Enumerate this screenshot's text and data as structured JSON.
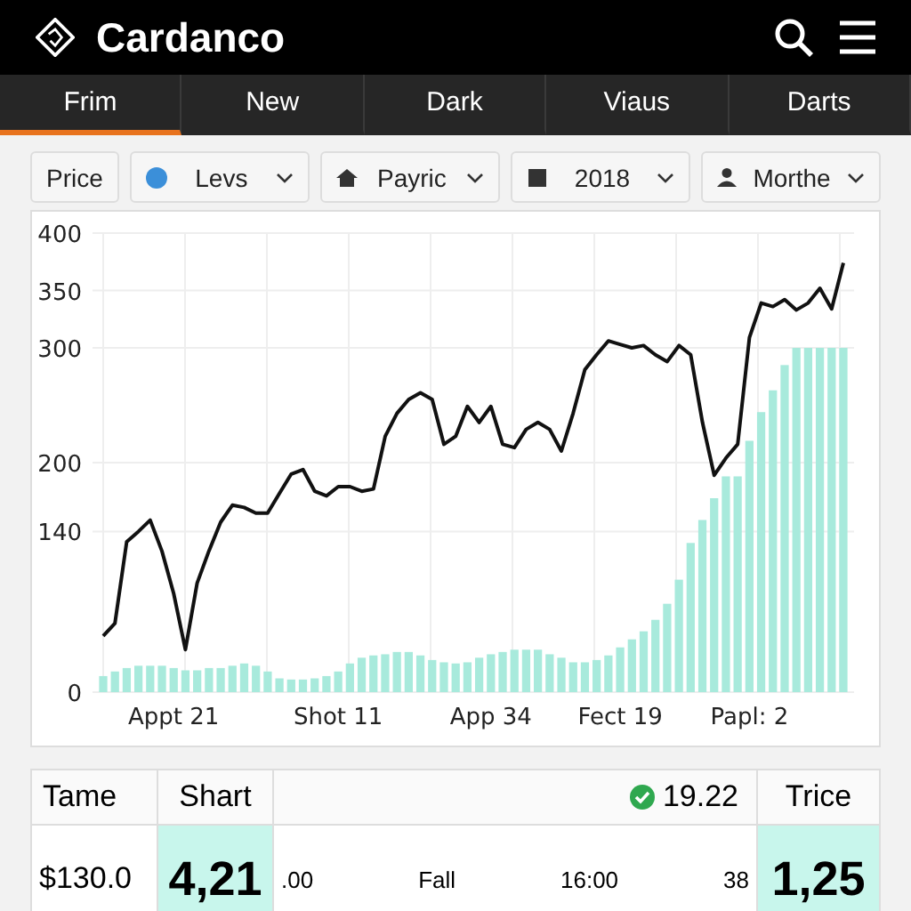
{
  "app": {
    "title": "Cardanco"
  },
  "tabs": [
    {
      "label": "Frim",
      "selected": true
    },
    {
      "label": "New",
      "selected": false
    },
    {
      "label": "Dark",
      "selected": false
    },
    {
      "label": "Viaus",
      "selected": false
    },
    {
      "label": "Darts",
      "selected": false
    }
  ],
  "filters": [
    {
      "kind": "button",
      "label": "Price"
    },
    {
      "kind": "dropdown",
      "label": "Levs"
    },
    {
      "kind": "dropdown",
      "label": "Payric"
    },
    {
      "kind": "dropdown",
      "label": "2018"
    },
    {
      "kind": "dropdown",
      "label": "Morthe"
    }
  ],
  "chart": {
    "chart_data": {
      "type": "line",
      "grid": true,
      "ylim": [
        0,
        400
      ],
      "yticks": [
        0,
        140,
        200,
        300,
        350,
        400
      ],
      "categories": [
        null,
        null,
        null,
        null,
        null,
        null,
        "Appt 21",
        null,
        null,
        null,
        null,
        null,
        null,
        null,
        null,
        null,
        null,
        null,
        null,
        null,
        "Shot 11",
        null,
        null,
        null,
        null,
        null,
        null,
        null,
        null,
        null,
        null,
        null,
        null,
        "App 34",
        null,
        null,
        null,
        null,
        null,
        null,
        null,
        null,
        null,
        null,
        "Fect 19",
        null,
        null,
        null,
        null,
        null,
        null,
        null,
        null,
        null,
        null,
        "Papl: 2",
        null,
        null,
        null,
        null,
        null,
        null,
        null,
        null
      ],
      "series": [
        {
          "type": "line",
          "color": "#111111",
          "values": [
            49,
            60,
            131,
            140,
            150,
            123,
            86,
            37,
            95,
            123,
            148,
            163,
            161,
            156,
            156,
            173,
            190,
            194,
            175,
            171,
            179,
            179,
            175,
            177,
            223,
            243,
            255,
            261,
            255,
            216,
            223,
            249,
            235,
            249,
            216,
            213,
            229,
            235,
            229,
            210,
            243,
            281,
            294,
            306,
            303,
            300,
            302,
            294,
            288,
            302,
            294,
            235,
            189,
            204,
            216,
            309,
            339,
            336,
            342,
            333,
            339,
            352,
            334,
            374
          ]
        },
        {
          "type": "bar",
          "color": "#a8eadc",
          "values": [
            14,
            18,
            21,
            23,
            23,
            23,
            21,
            19,
            19,
            21,
            21,
            23,
            25,
            23,
            18,
            12,
            11,
            11,
            12,
            14,
            18,
            25,
            30,
            32,
            33,
            35,
            35,
            32,
            28,
            26,
            25,
            26,
            30,
            33,
            35,
            37,
            37,
            37,
            33,
            30,
            26,
            26,
            28,
            32,
            39,
            46,
            53,
            63,
            77,
            98,
            130,
            150,
            169,
            188,
            188,
            219,
            244,
            263,
            285,
            300,
            300,
            300,
            300,
            300
          ]
        }
      ]
    }
  },
  "table": {
    "columns": [
      {
        "label": "Tame"
      },
      {
        "label": "Shart"
      },
      {
        "label": "19.22",
        "checked": true
      },
      {
        "label": "Trice"
      }
    ],
    "row": [
      ".00",
      "Fall",
      "16:00"
    ],
    "first": "$130.0",
    "second": "4,21",
    "lead": "38",
    "last": "1,25"
  }
}
